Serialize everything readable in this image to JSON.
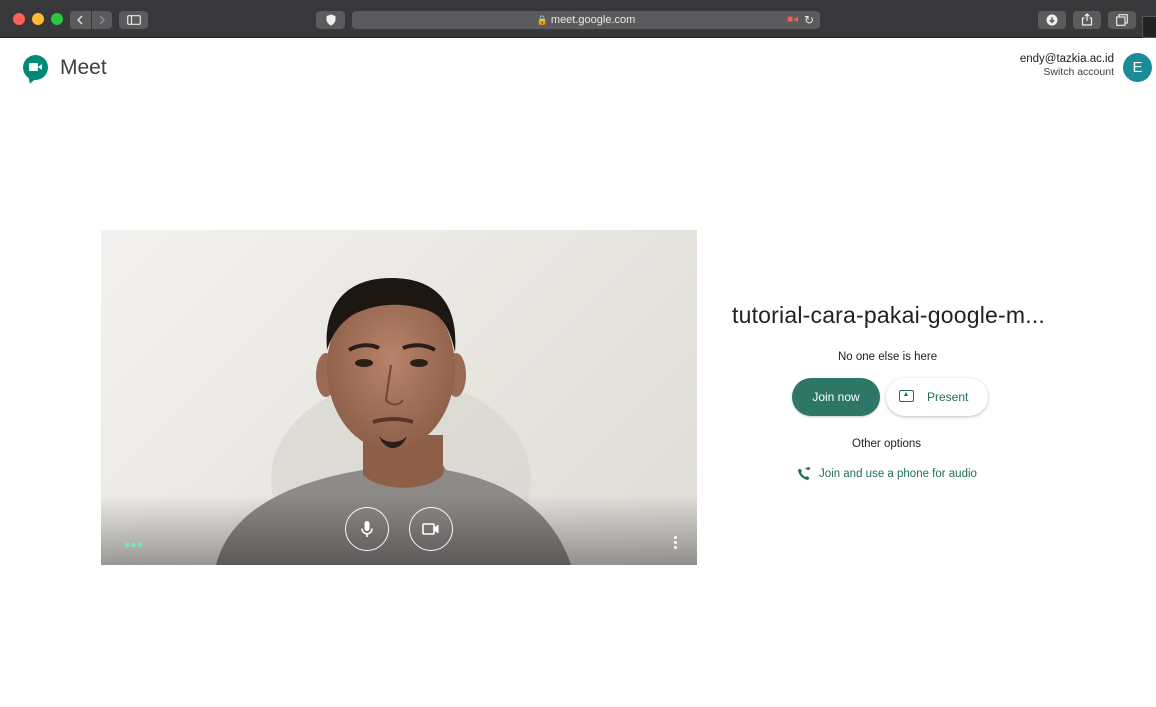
{
  "browser": {
    "url": "meet.google.com"
  },
  "app": {
    "name": "Meet"
  },
  "account": {
    "email": "endy@tazkia.ac.id",
    "switch_label": "Switch account",
    "avatar_letter": "E"
  },
  "meeting": {
    "name": "tutorial-cara-pakai-google-m...",
    "status": "No one else is here",
    "join_label": "Join now",
    "present_label": "Present",
    "other_options": "Other options",
    "phone_audio_label": "Join and use a phone for audio"
  },
  "preview": {
    "mic_icon": "microphone-icon",
    "camera_icon": "video-camera-icon",
    "effects_indicator": "•••"
  },
  "colors": {
    "brand": "#00897b",
    "join_button": "#2e7667",
    "link": "#1e6f5c",
    "avatar": "#1b8a99"
  }
}
